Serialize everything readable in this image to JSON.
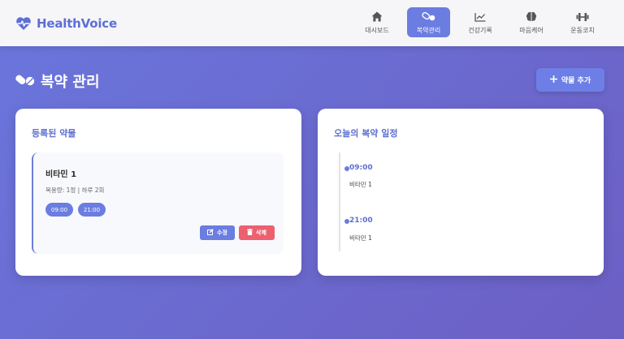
{
  "app": {
    "name": "HealthVoice",
    "brand_color": "#5e6fd6",
    "logo_icon": "heart-pulse-icon"
  },
  "nav": {
    "items": [
      {
        "label": "대시보드",
        "icon": "home-icon",
        "active": false
      },
      {
        "label": "복약관리",
        "icon": "pills-icon",
        "active": true
      },
      {
        "label": "건강기록",
        "icon": "chart-line-icon",
        "active": false
      },
      {
        "label": "마음케어",
        "icon": "brain-icon",
        "active": false
      },
      {
        "label": "운동코치",
        "icon": "dumbbell-icon",
        "active": false
      }
    ]
  },
  "page": {
    "title": "복약 관리",
    "title_icon": "pills-icon",
    "add_button": "약물 추가"
  },
  "medications_card": {
    "title": "등록된 약물",
    "items": [
      {
        "name": "비타민 1",
        "detail": "복용량: 1정 | 하루 2회",
        "times": [
          "09:00",
          "21:00"
        ],
        "edit_label": "수정",
        "delete_label": "삭제"
      }
    ]
  },
  "schedule_card": {
    "title": "오늘의 복약 일정",
    "entries": [
      {
        "time": "09:00",
        "medication": "비타민 1"
      },
      {
        "time": "21:00",
        "medication": "비타민 1"
      }
    ]
  },
  "colors": {
    "accent": "#6b7de0",
    "danger": "#ec6070",
    "background_start": "#6a76dc",
    "background_end": "#6c5fc4"
  }
}
